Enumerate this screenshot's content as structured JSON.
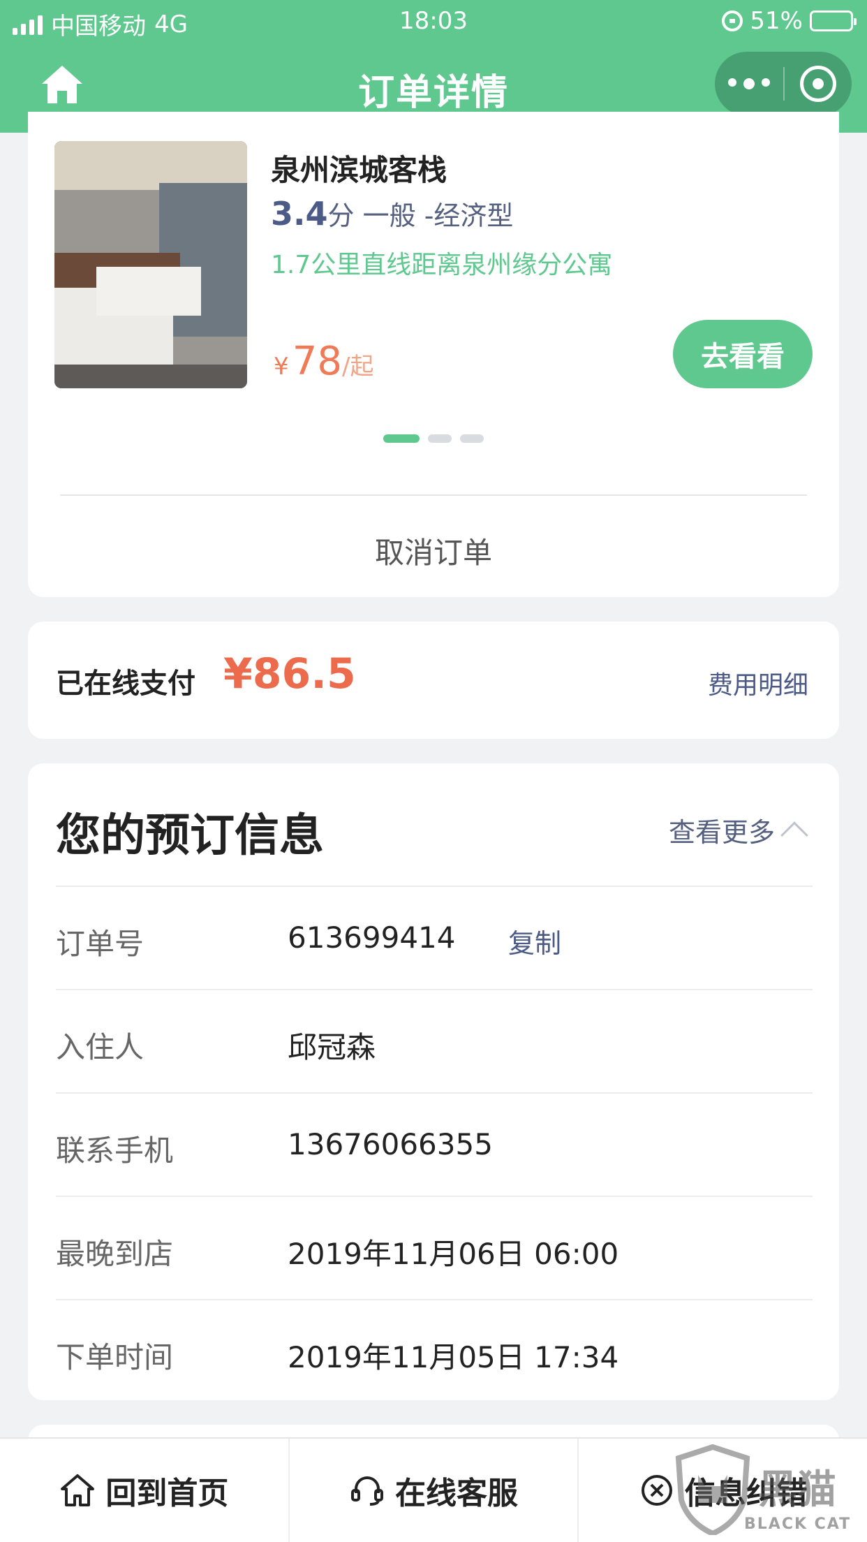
{
  "status_bar": {
    "carrier": "中国移动",
    "network": "4G",
    "time": "18:03",
    "battery": "51%"
  },
  "nav": {
    "title": "订单详情"
  },
  "hotel": {
    "name": "泉州滨城客栈",
    "score": "3.4",
    "score_unit": "分",
    "rating_text": "一般 -经济型",
    "distance": "1.7公里直线距离泉州缘分公寓",
    "price_currency": "¥",
    "price": "78",
    "price_unit": "/起",
    "go_button": "去看看",
    "carousel_pages": 3,
    "carousel_active": 0,
    "cancel_label": "取消订单"
  },
  "payment": {
    "label": "已在线支付",
    "amount": "¥86.5",
    "detail_link": "费用明细"
  },
  "booking_info": {
    "title": "您的预订信息",
    "see_more": "查看更多",
    "rows": [
      {
        "key": "订单号",
        "value": "613699414",
        "action": "复制"
      },
      {
        "key": "入住人",
        "value": "邱冠森"
      },
      {
        "key": "联系手机",
        "value": "13676066355"
      },
      {
        "key": "最晚到店",
        "value": "2019年11月06日 06:00"
      },
      {
        "key": "下单时间",
        "value": "2019年11月05日 17:34"
      }
    ]
  },
  "bottom_bar": {
    "home": "回到首页",
    "service": "在线客服",
    "report": "信息纠错"
  },
  "watermark": {
    "text": "黑猫",
    "sub": "BLACK CAT"
  },
  "colors": {
    "brand_green": "#5fc88f",
    "price_orange": "#ec6b4c",
    "link_blue": "#4b5a86"
  }
}
